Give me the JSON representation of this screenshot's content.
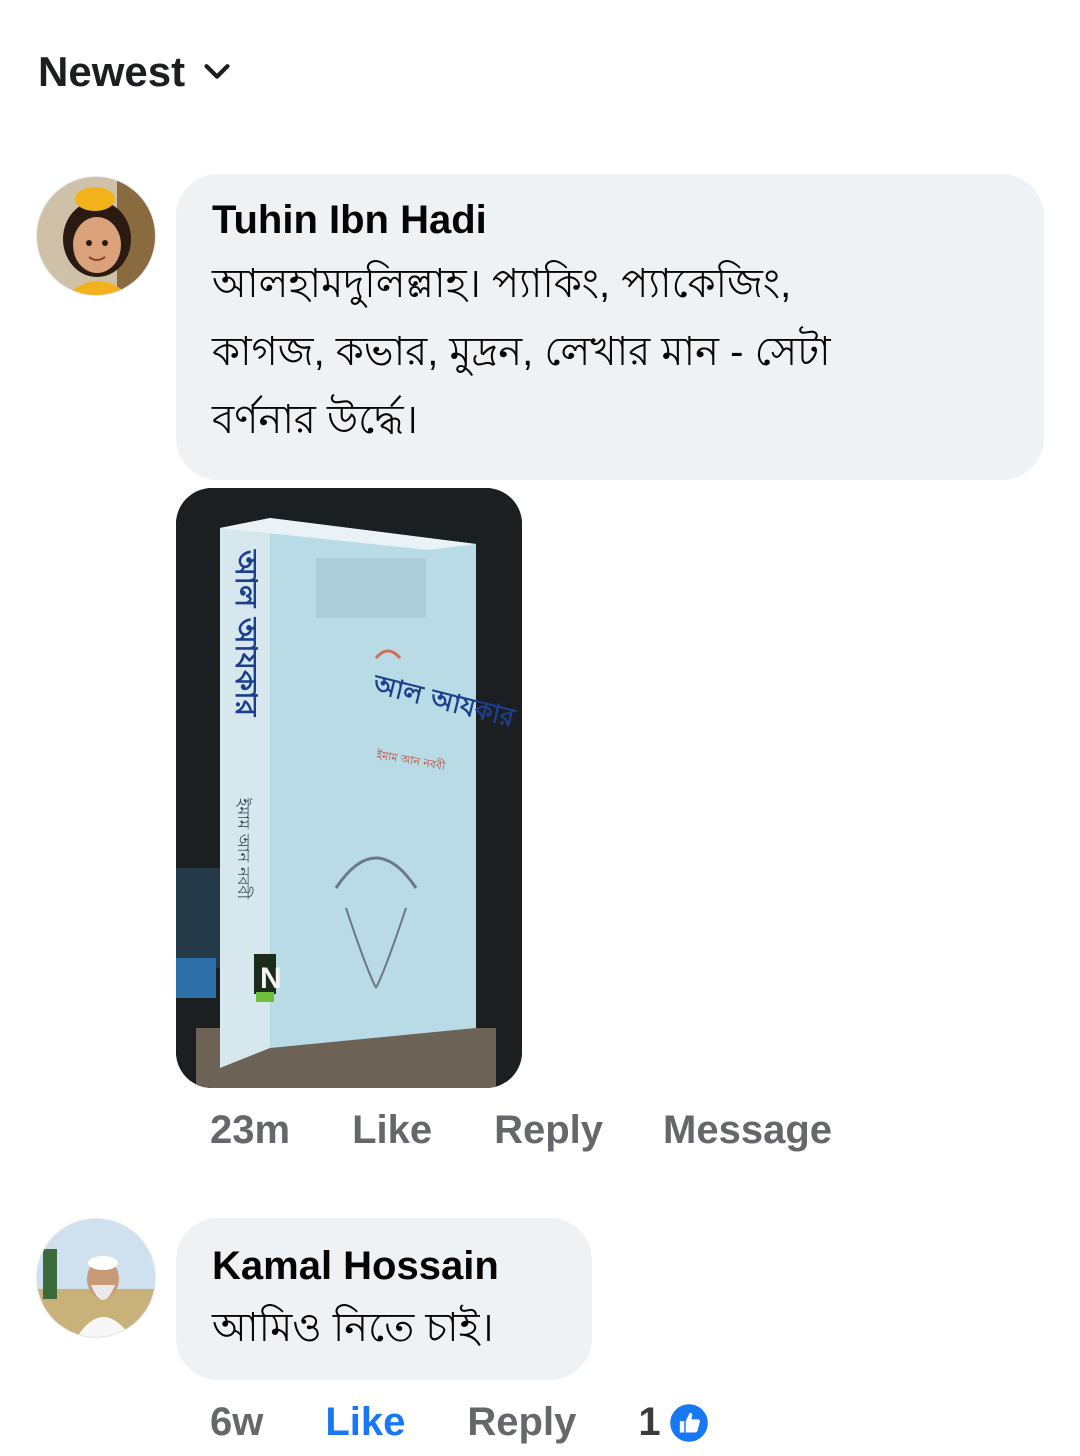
{
  "sort": {
    "label": "Newest"
  },
  "comments": [
    {
      "author": "Tuhin Ibn Hadi",
      "text_lines": [
        "আলহামদুলিল্লাহ। প্যাকিং, প্যাকেজিং,",
        "কাগজ, কভার, মুদ্রন, লেখার মান - সেটা",
        "বর্ণনার উর্দ্ধে।"
      ],
      "time": "23m",
      "like": "Like",
      "reply": "Reply",
      "message": "Message",
      "attachment": {
        "spine_title": "আল আযকার",
        "spine_author": "ইমাম আন নববী",
        "cover_title": "আল আযকার",
        "cover_author": "ইমাম আন নববী",
        "publisher_mark": "N"
      }
    },
    {
      "author": "Kamal Hossain",
      "text_lines": [
        "আমিও নিতে চাই।"
      ],
      "time": "6w",
      "like": "Like",
      "reply": "Reply",
      "reaction_count": "1"
    }
  ],
  "colors": {
    "bubble": "#eff2f5",
    "meta": "#65676b",
    "like_active": "#1877f2"
  }
}
